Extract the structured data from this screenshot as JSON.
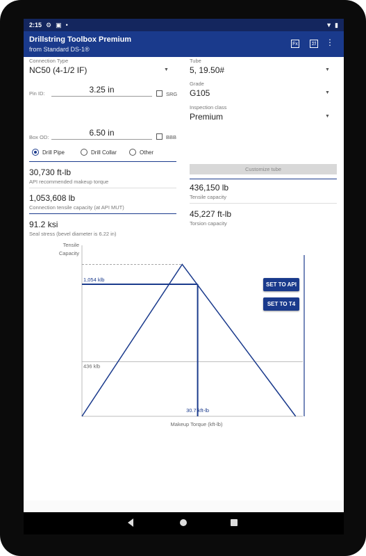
{
  "status_bar": {
    "time": "2:15"
  },
  "app_bar": {
    "title": "Drillstring Toolbox Premium",
    "subtitle": "from Standard DS-1®",
    "actions": [
      "ruler-icon",
      "sigma-icon",
      "more-vert-icon"
    ],
    "action_glyph_1": "Fx",
    "action_glyph_2": "Σf"
  },
  "connection": {
    "type_label": "Connection Type",
    "type_value": "NC50 (4-1/2 IF)",
    "pin_id_label": "Pin ID:",
    "pin_id_value": "3.25 in",
    "srg_label": "SRG",
    "box_od_label": "Box OD:",
    "box_od_value": "6.50 in",
    "bbb_label": "BBB",
    "radio_options": [
      "Drill Pipe",
      "Drill Collar",
      "Other"
    ],
    "radio_selected": "Drill Pipe"
  },
  "tube": {
    "tube_label": "Tube",
    "tube_value": "5, 19.50#",
    "grade_label": "Grade",
    "grade_value": "G105",
    "class_label": "Inspection class",
    "class_value": "Premium",
    "customize_button": "Customize tube"
  },
  "results_left": [
    {
      "value": "30,730 ft-lb",
      "label": "API recommended makeup torque"
    },
    {
      "value": "1,053,608 lb",
      "label": "Connection tensile capacity (at API MUT)"
    },
    {
      "value": "91.2 ksi",
      "label": "Seal stress (bevel diameter is 6.22 in)"
    }
  ],
  "results_right": [
    {
      "value": "436,150 lb",
      "label": "Tensile capacity"
    },
    {
      "value": "45,227 ft-lb",
      "label": "Torsion capacity"
    }
  ],
  "chart_buttons": {
    "set_api": "SET TO API",
    "set_t4": "SET TO T4"
  },
  "colors": {
    "primary": "#1a3a8c",
    "status_bar": "#14265e"
  },
  "chart_data": {
    "type": "line",
    "ylabel": "Tensile\nCapacity",
    "xlabel": "Makeup Torque (kft-lb)",
    "annotations": {
      "connection_tensile": "1,054 klb",
      "tube_tensile": "436 klb",
      "api_mut": "30.7 kft-lb"
    },
    "ylabel_line1": "Tensile",
    "ylabel_line2": "Capacity",
    "series": [
      {
        "x": [
          0,
          26.6,
          56.7
        ],
        "y": [
          0,
          1213,
          0
        ]
      }
    ],
    "api_mut": 30.7,
    "connection_tensile_klb": 1054,
    "tube_tensile_klb": 436,
    "torsion_capacity_kft_lb": 45.2,
    "xlim": [
      0,
      58.6
    ],
    "ylim": [
      0,
      1365
    ]
  }
}
